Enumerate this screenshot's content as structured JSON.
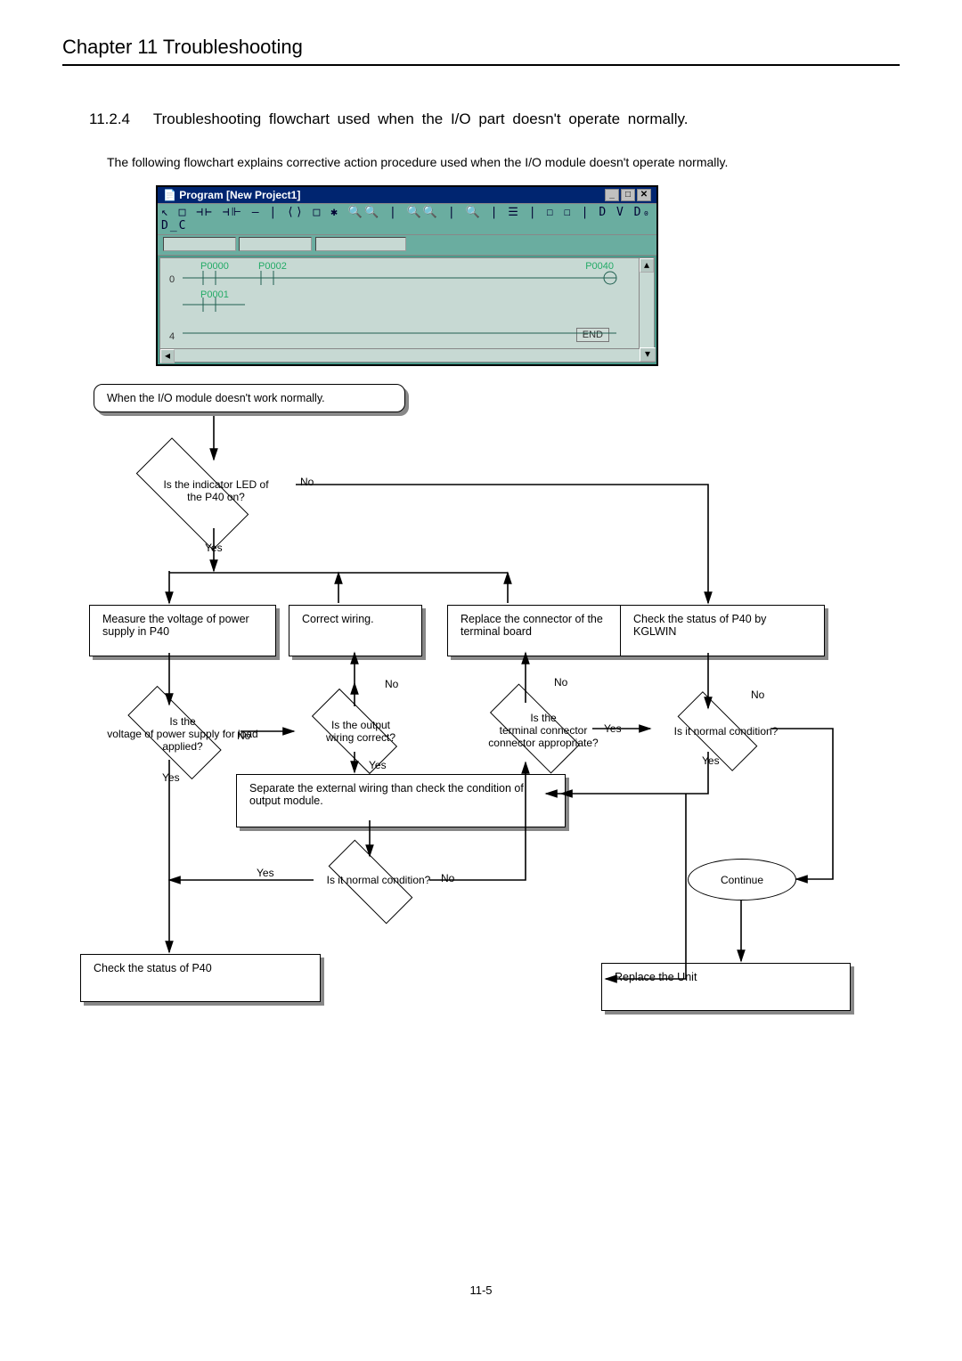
{
  "chapter_title": "Chapter 11    Troubleshooting",
  "section": {
    "number": "11.2.4",
    "title": "Troubleshooting  flowchart  used  when  the  I/O part  doesn't  operate normally."
  },
  "intro": "The following flowchart explains corrective action procedure used when the  I/O module  doesn't  operate normally.",
  "program_window": {
    "title_icon": "📄",
    "title": "Program [New Project1]",
    "toolbar_glyphs": "↖ □ ⊣⊢ ⊣⊩ — | ⟨⟩ □ ✱  🔍🔍 | 🔍🔍 | 🔍 | ☰ | ☐ ☐ |  D  V  D₀  D_C",
    "row0": "0",
    "p0000": "P0000",
    "p0002": "P0002",
    "p0040": "P0040",
    "p0001": "P0001",
    "row4": "4",
    "end": "END"
  },
  "flow": {
    "start": "When the I/O module doesn't work normally.",
    "d_led": "Is the indicator LED of\nthe P40 on?",
    "measure": "Measure the voltage of power supply in P40",
    "correct_wiring": "Correct wiring.",
    "replace_connector": "Replace the connector of the terminal board",
    "check_kglwin": "Check  the  status  of  P40  by KGLWIN",
    "d_voltage": "Is the\nvoltage of power supply for load\napplied?",
    "d_wiring": "Is the output\nwiring correct?",
    "d_terminal": "Is the\nterminal connector\nconnector appropriate?",
    "d_normal1": "Is it normal condition?",
    "separate": "Separate  the  external  wiring  than  check  the  condition of output module.",
    "d_normal2": "Is it normal condition?",
    "check_p40": "Check the status of P40",
    "replace_unit": "Replace the Unit",
    "continue": "Continue",
    "yes": "Yes",
    "no": "No"
  },
  "page_number": "11-5"
}
